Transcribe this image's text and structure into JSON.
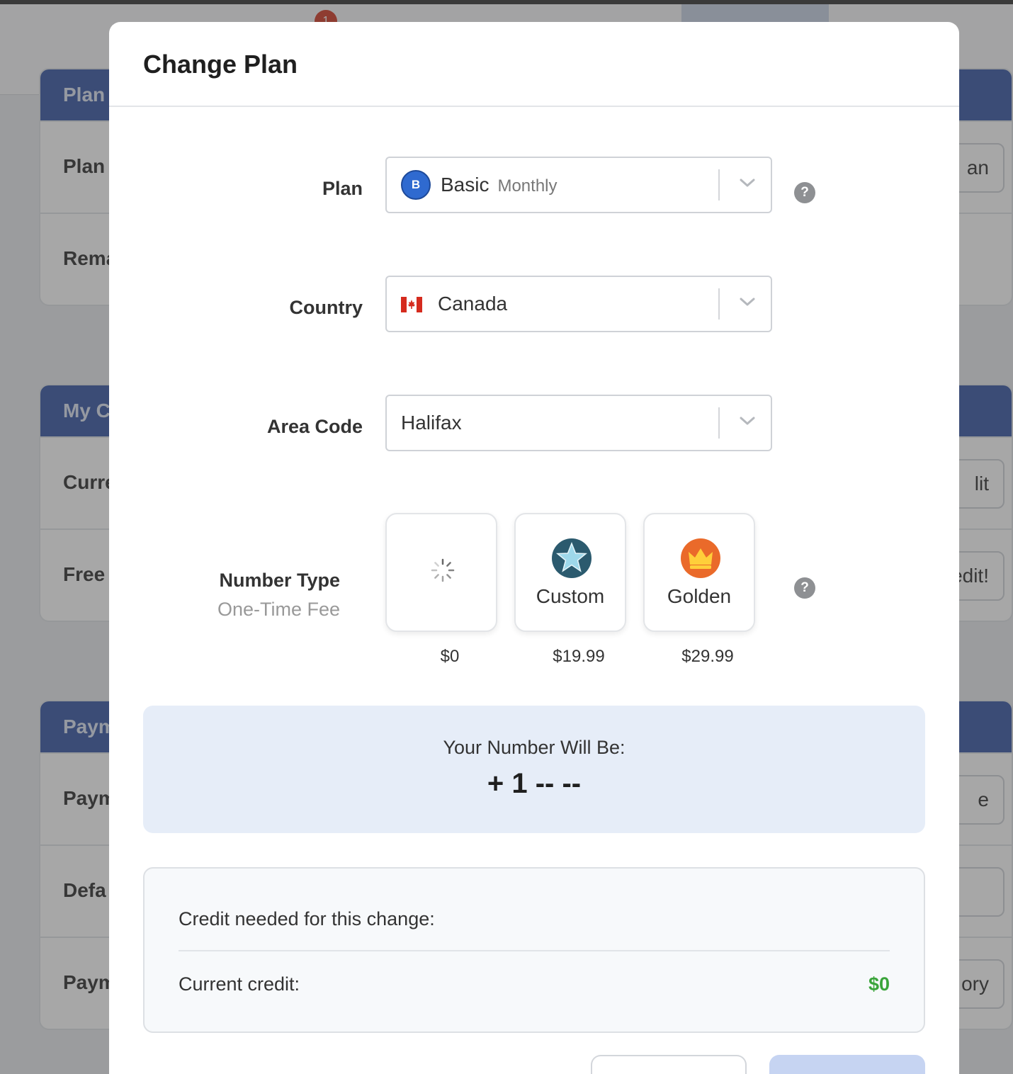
{
  "background": {
    "notification_count": "1",
    "cards": [
      {
        "header": "Plan I",
        "rows": [
          {
            "label": "Plan T",
            "button": "an"
          },
          {
            "label": "Rema",
            "button": ""
          }
        ]
      },
      {
        "header": "My C",
        "rows": [
          {
            "label": "Curre",
            "button": "lit"
          },
          {
            "label": "Free (",
            "button": "edit!"
          }
        ]
      },
      {
        "header": "Paym",
        "rows": [
          {
            "label": "Paym",
            "button": "e"
          },
          {
            "label": "Defa",
            "button": ""
          },
          {
            "label": "Paym",
            "button": "ory"
          }
        ]
      }
    ]
  },
  "modal": {
    "title": "Change Plan",
    "plan": {
      "label": "Plan",
      "badge_letter": "B",
      "value": "Basic",
      "sub": "Monthly"
    },
    "country": {
      "label": "Country",
      "value": "Canada"
    },
    "area_code": {
      "label": "Area Code",
      "value": "Halifax"
    },
    "number_type": {
      "label": "Number Type",
      "sublabel": "One-Time Fee",
      "options": [
        {
          "name": "",
          "price": "$0",
          "icon": "loading-spinner-icon"
        },
        {
          "name": "Custom",
          "price": "$19.99",
          "icon": "star-icon"
        },
        {
          "name": "Golden",
          "price": "$29.99",
          "icon": "crown-icon"
        }
      ]
    },
    "help_symbol": "?",
    "number_preview": {
      "label": "Your Number Will Be:",
      "value": "+ 1 -- --"
    },
    "credit": {
      "needed_label": "Credit needed for this change:",
      "current_label": "Current credit:",
      "current_value": "$0"
    }
  },
  "colors": {
    "accent": "#3b5aa6",
    "credit_positive": "#3aa43a",
    "number_box_bg": "#e6edf8"
  }
}
